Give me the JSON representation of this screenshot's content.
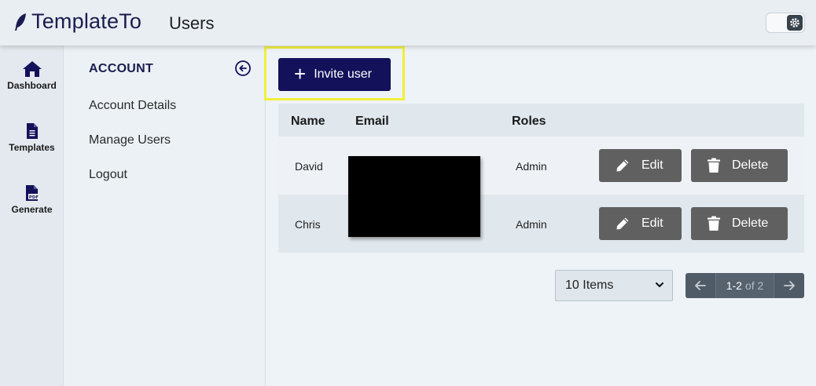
{
  "header": {
    "brand": "TemplateTo",
    "page_title": "Users",
    "brand_icon": "feather-icon",
    "settings_icon": "gear-icon"
  },
  "rail": {
    "items": [
      {
        "label": "Dashboard",
        "icon": "home-icon"
      },
      {
        "label": "Templates",
        "icon": "document-icon"
      },
      {
        "label": "Generate",
        "icon": "pdf-file-icon"
      }
    ]
  },
  "subnav": {
    "heading": "ACCOUNT",
    "links": [
      "Account Details",
      "Manage Users",
      "Logout"
    ],
    "collapse_icon": "arrow-left-circle-icon"
  },
  "toolbar": {
    "invite_label": "Invite user"
  },
  "table": {
    "columns": [
      "Name",
      "Email",
      "Roles"
    ],
    "rows": [
      {
        "name": "David",
        "email": "",
        "role": "Admin",
        "edit_label": "Edit",
        "delete_label": "Delete"
      },
      {
        "name": "Chris",
        "email": "",
        "role": "Admin",
        "edit_label": "Edit",
        "delete_label": "Delete"
      }
    ]
  },
  "pagination": {
    "page_size_selected": "10 Items",
    "range": "1-2",
    "total": "of 2"
  },
  "colors": {
    "primary": "#13115a",
    "highlight": "#f0f03a",
    "action_button": "#606060",
    "pager": "#4f5b66"
  }
}
